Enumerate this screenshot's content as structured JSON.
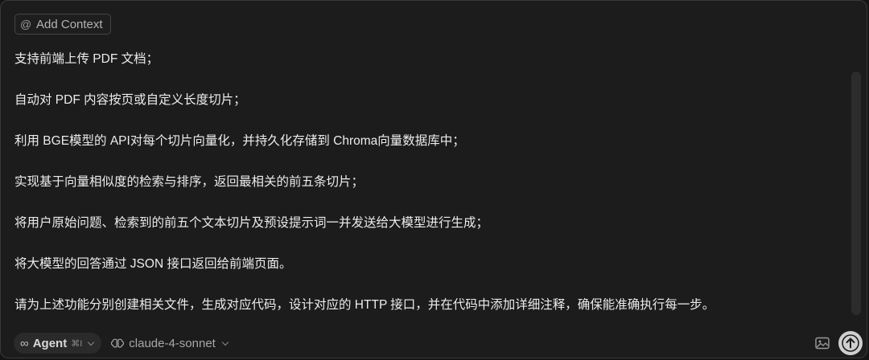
{
  "context_button": {
    "icon": "at-icon",
    "label": "Add Context"
  },
  "message_lines": [
    "支持前端上传 PDF 文档；",
    "自动对 PDF 内容按页或自定义长度切片；",
    "利用 BGE模型的 API对每个切片向量化，并持久化存储到 Chroma向量数据库中；",
    "实现基于向量相似度的检索与排序，返回最相关的前五条切片；",
    "将用户原始问题、检索到的前五个文本切片及预设提示词一并发送给大模型进行生成；",
    "将大模型的回答通过 JSON 接口返回给前端页面。",
    "请为上述功能分别创建相关文件，生成对应代码，设计对应的 HTTP 接口，并在代码中添加详细注释，确保能准确执行每一步。"
  ],
  "footer": {
    "mode_label": "Agent",
    "mode_shortcut": "⌘I",
    "model_label": "claude-4-sonnet"
  },
  "colors": {
    "panel_bg": "#1c1c1c",
    "text": "#ececec",
    "send_button": "#cfcfcf"
  }
}
